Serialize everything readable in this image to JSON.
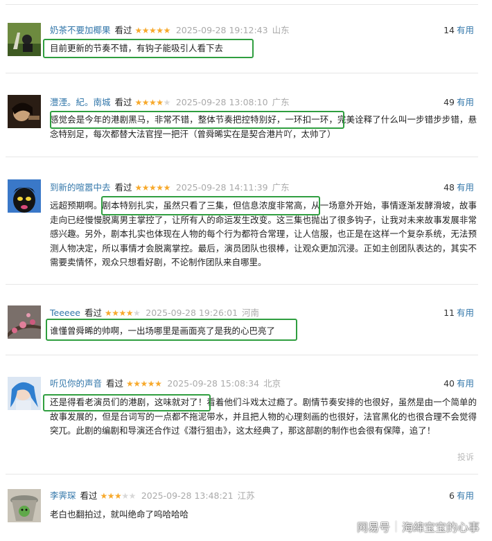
{
  "comments": [
    {
      "username": "奶茶不要加椰果",
      "watched": "看过",
      "rating": 5,
      "time": "2025-09-28 19:12:43",
      "location": "山东",
      "useful_count": "14",
      "useful_label": "有用",
      "text": "目前更新的节奏不错，有钩子能吸引人看下去"
    },
    {
      "username": "灃湮。紀。南城",
      "watched": "看过",
      "rating": 4,
      "time": "2025-09-28 13:08:10",
      "location": "广东",
      "useful_count": "49",
      "useful_label": "有用",
      "text": "感觉会是今年的港剧黑马，非常不错，整体节奏把控特别好，一环扣一环，完美诠释了什么叫一步错步步错，悬念特别足，每次都替大法官捏一把汗（曾舜晞实在是契合港片吖，太帅了）"
    },
    {
      "username": "到新的喧嚣中去",
      "watched": "看过",
      "rating": 5,
      "time": "2025-09-28 14:11:39",
      "location": "广东",
      "useful_count": "48",
      "useful_label": "有用",
      "text": "远超预期啊。剧本特别扎实，虽然只看了三集，但信息浓度非常高，从一场意外开始，事情逐渐发酵滑坡，故事走向已经慢慢脱离男主掌控了，让所有人的命运发生改变。这三集也抛出了很多钩子，让我对未来故事发展非常感兴趣。另外，剧本扎实也体现在人物的每个行为都符合常理，让人信服，也正是在这样一个复杂系统，无法预测人物决定，所以事情才会脱离掌控。最后，演员团队也很棒，让观众更加沉浸。正如主创团队表达的，其实不需要卖情怀，观众只想看好剧，不论制作团队来自哪里。"
    },
    {
      "username": "Teeeee",
      "watched": "看过",
      "rating": 4,
      "time": "2025-09-28 19:26:01",
      "location": "河南",
      "useful_count": "11",
      "useful_label": "有用",
      "text": "谁懂曾舜晞的帅啊，一出场哪里是画面亮了是我的心巴亮了"
    },
    {
      "username": "听见你的声音",
      "watched": "看过",
      "rating": 5,
      "time": "2025-09-28 15:08:34",
      "location": "北京",
      "useful_count": "40",
      "useful_label": "有用",
      "text": "还是得看老演员们的港剧，这味就对了！看着他们斗戏太过瘾了。剧情节奏安排的也很好，虽然是由一个简单的故事发展的，但是台词写的一点都不拖泥带水，并且把人物的心理刻画的也很好，法官黑化的也很合理不会觉得突兀。此剧的编剧和导演还合作过《潜行狙击》，这太经典了，那这部剧的制作也会很有保障，追了！",
      "report_label": "投诉"
    },
    {
      "username": "李霁琛",
      "watched": "看过",
      "rating": 3,
      "time": "2025-09-28 13:48:21",
      "location": "江苏",
      "useful_count": "6",
      "useful_label": "有用",
      "text": "老白也翻拍过，就叫绝命了呜哈哈哈"
    }
  ],
  "watermark": {
    "brand": "网易号",
    "account": "海绵宝宝的心事"
  },
  "colors": {
    "link": "#3377aa",
    "star": "#f7a92c",
    "highlight_border": "#2f9e3f",
    "meta_gray": "#aaaaaa"
  }
}
